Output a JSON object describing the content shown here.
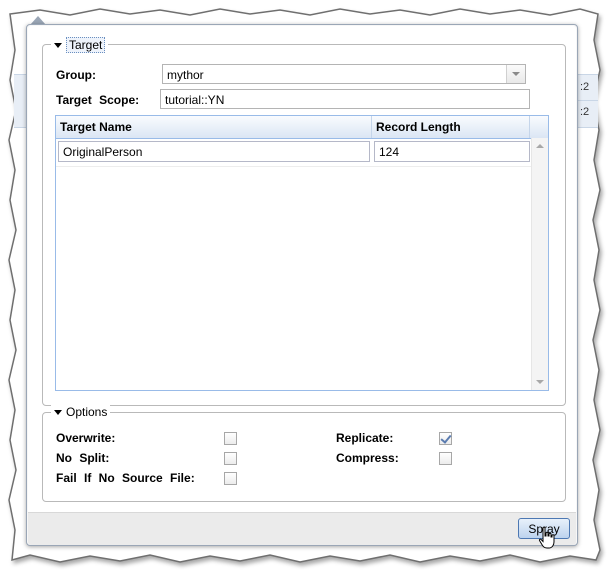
{
  "background_app": {
    "row1_text": ":2",
    "row2_text": ":2"
  },
  "target_group": {
    "legend": "Target",
    "group_label": "Group:",
    "group_value": "mythor",
    "scope_label": "Target Scope:",
    "scope_value": "tutorial::YN",
    "table": {
      "columns": [
        "Target Name",
        "Record Length"
      ],
      "rows": [
        {
          "target_name": "OriginalPerson",
          "record_length": "124"
        }
      ]
    }
  },
  "options_group": {
    "legend": "Options",
    "overwrite_label": "Overwrite:",
    "overwrite_checked": false,
    "no_split_label": "No Split:",
    "no_split_checked": false,
    "fail_label": "Fail If No Source File:",
    "fail_checked": false,
    "replicate_label": "Replicate:",
    "replicate_checked": true,
    "compress_label": "Compress:",
    "compress_checked": false
  },
  "footer": {
    "spray_label": "Spray"
  },
  "colors": {
    "grid_border": "#99bbe8",
    "button_border": "#4d78b3",
    "accent_check": "#5b7cb0"
  }
}
